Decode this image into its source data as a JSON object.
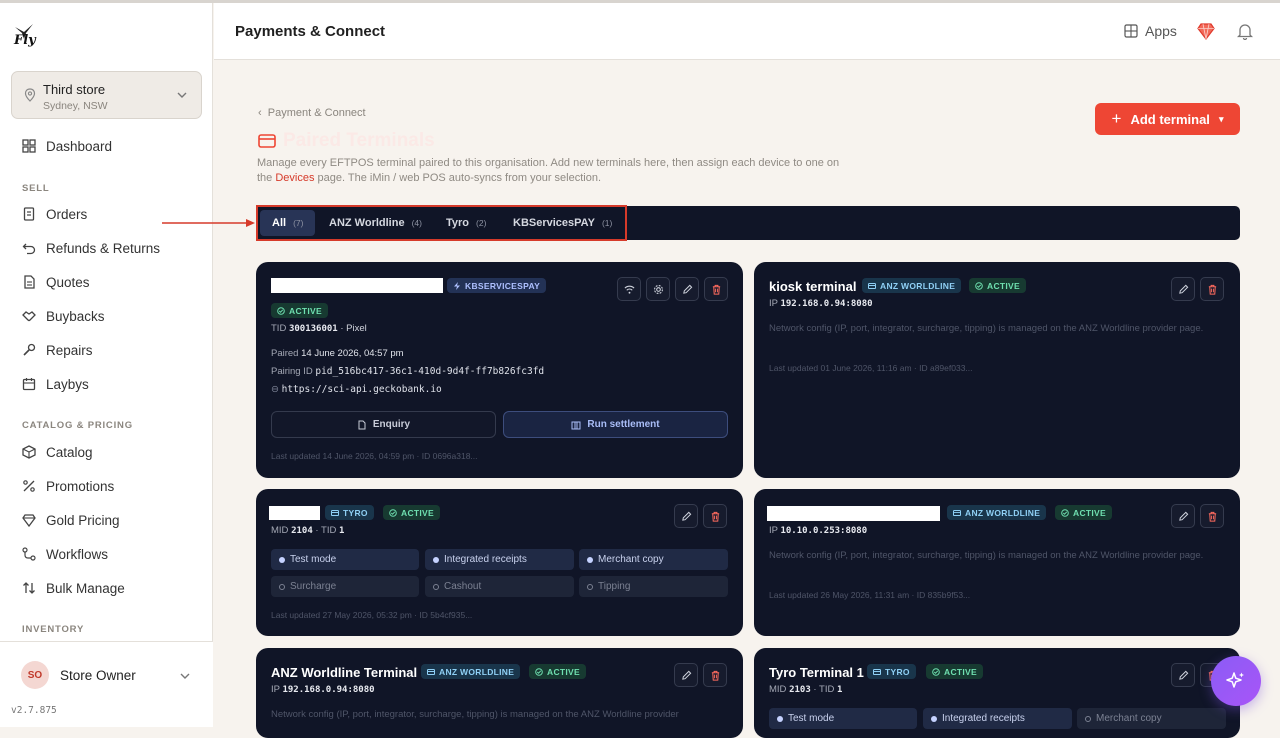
{
  "brand": {
    "logo_text": "Fly"
  },
  "store": {
    "name": "Third store",
    "location": "Sydney, NSW"
  },
  "nav": {
    "items": [
      {
        "label": "Dashboard",
        "icon": "dashboard-icon"
      }
    ],
    "sell_title": "SELL",
    "sell": [
      {
        "label": "Orders"
      },
      {
        "label": "Refunds & Returns"
      },
      {
        "label": "Quotes"
      },
      {
        "label": "Buybacks"
      },
      {
        "label": "Repairs"
      },
      {
        "label": "Laybys"
      }
    ],
    "catalog_title": "CATALOG & PRICING",
    "catalog": [
      {
        "label": "Catalog"
      },
      {
        "label": "Promotions"
      },
      {
        "label": "Gold Pricing"
      },
      {
        "label": "Workflows"
      },
      {
        "label": "Bulk Manage"
      }
    ],
    "inventory_title": "INVENTORY"
  },
  "user": {
    "initials": "SO",
    "name": "Store Owner"
  },
  "version": "v2.7.875",
  "header": {
    "title": "Payments & Connect",
    "apps_label": "Apps"
  },
  "breadcrumb": "Payment & Connect",
  "page": {
    "title": "Paired Terminals",
    "desc_before": "Manage every EFTPOS terminal paired to this organisation. Add new terminals here, then assign each device to one on the ",
    "desc_link": "Devices",
    "desc_after": " page. The iMin / web POS auto-syncs from your selection.",
    "add_button": "Add terminal"
  },
  "tabs": [
    {
      "label": "All",
      "count": "(7)"
    },
    {
      "label": "ANZ Worldline",
      "count": "(4)"
    },
    {
      "label": "Tyro",
      "count": "(2)"
    },
    {
      "label": "KBServicesPAY",
      "count": "(1)"
    }
  ],
  "cards": {
    "kb": {
      "provider": "KBSERVICESPAY",
      "status": "ACTIVE",
      "tid_label": "TID",
      "tid": "300136001",
      "device": " · Pixel",
      "paired_label": "Paired",
      "paired": "14 June 2026, 04:57 pm",
      "pairing_label": "Pairing ID",
      "pairing_id": "pid_516bc417-36c1-410d-9d4f-ff7b826fc3fd",
      "url": "https://sci-api.geckobank.io",
      "enquiry": "Enquiry",
      "settlement": "Run settlement",
      "updated": "Last updated 14 June 2026, 04:59 pm · ID 0696a318..."
    },
    "kiosk": {
      "name": "kiosk terminal",
      "provider": "ANZ WORLDLINE",
      "status": "ACTIVE",
      "ip_label": "IP",
      "ip": "192.168.0.94:8080",
      "note": "Network config (IP, port, integrator, surcharge, tipping) is managed on the ANZ Worldline provider page.",
      "updated": "Last updated 01 June 2026, 11:16 am · ID a89ef033..."
    },
    "tyro1": {
      "provider": "TYRO",
      "status": "ACTIVE",
      "mid_label": "MID",
      "mid": "2104",
      "tid_label": " · TID",
      "tid": "1",
      "chips": [
        {
          "label": "Test mode",
          "on": true
        },
        {
          "label": "Integrated receipts",
          "on": true
        },
        {
          "label": "Merchant copy",
          "on": true
        },
        {
          "label": "Surcharge",
          "on": false
        },
        {
          "label": "Cashout",
          "on": false
        },
        {
          "label": "Tipping",
          "on": false
        }
      ],
      "updated": "Last updated 27 May 2026, 05:32 pm · ID 5b4cf935..."
    },
    "anz2": {
      "provider": "ANZ WORLDLINE",
      "status": "ACTIVE",
      "ip_label": "IP",
      "ip": "10.10.0.253:8080",
      "note": "Network config (IP, port, integrator, surcharge, tipping) is managed on the ANZ Worldline provider page.",
      "updated": "Last updated 26 May 2026, 11:31 am · ID 835b9f53..."
    },
    "anz3": {
      "name": "ANZ Worldline Terminal",
      "provider": "ANZ WORLDLINE",
      "status": "ACTIVE",
      "ip_label": "IP",
      "ip": "192.168.0.94:8080",
      "note": "Network config (IP, port, integrator, surcharge, tipping) is managed on the ANZ Worldline provider"
    },
    "tyro2": {
      "name": "Tyro Terminal 1",
      "provider": "TYRO",
      "status": "ACTIVE",
      "mid_label": "MID",
      "mid": "2103",
      "tid_label": " · TID",
      "tid": "1",
      "chips": [
        {
          "label": "Test mode"
        },
        {
          "label": "Integrated receipts"
        },
        {
          "label": "Merchant copy"
        }
      ]
    }
  },
  "colors": {
    "accent": "#ee4634",
    "card_bg": "#101527",
    "active_green": "#6fe0b0"
  }
}
